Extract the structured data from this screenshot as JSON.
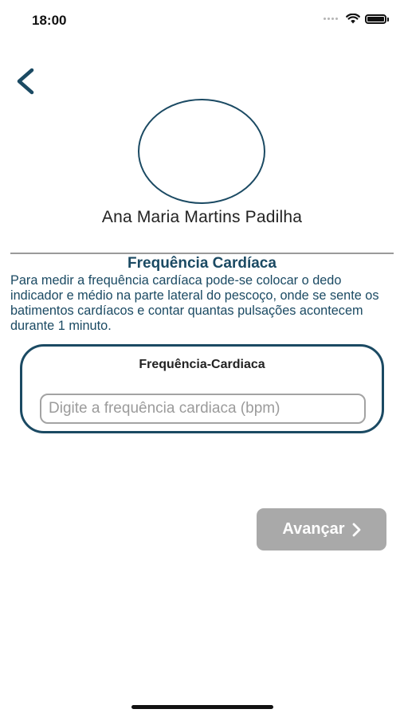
{
  "status_bar": {
    "time": "18:00"
  },
  "profile": {
    "name": "Ana Maria Martins Padilha"
  },
  "section": {
    "title": "Frequência Cardíaca",
    "description": "Para medir a frequência cardíaca pode-se colocar o dedo indicador e médio na parte lateral do pescoço, onde se sente os batimentos cardíacos e contar quantas pulsações acontecem durante 1 minuto."
  },
  "heart_rate_card": {
    "label": "Frequência-Cardiaca",
    "input_value": "",
    "placeholder": "Digite a frequência cardiaca (bpm)"
  },
  "next_button": {
    "label": "Avançar"
  },
  "colors": {
    "primary": "#1b4a63",
    "button_disabled": "#a9a9a9",
    "divider": "#9a9a9a"
  },
  "icons": {
    "back": "chevron-left-icon",
    "next": "chevron-right-icon"
  }
}
